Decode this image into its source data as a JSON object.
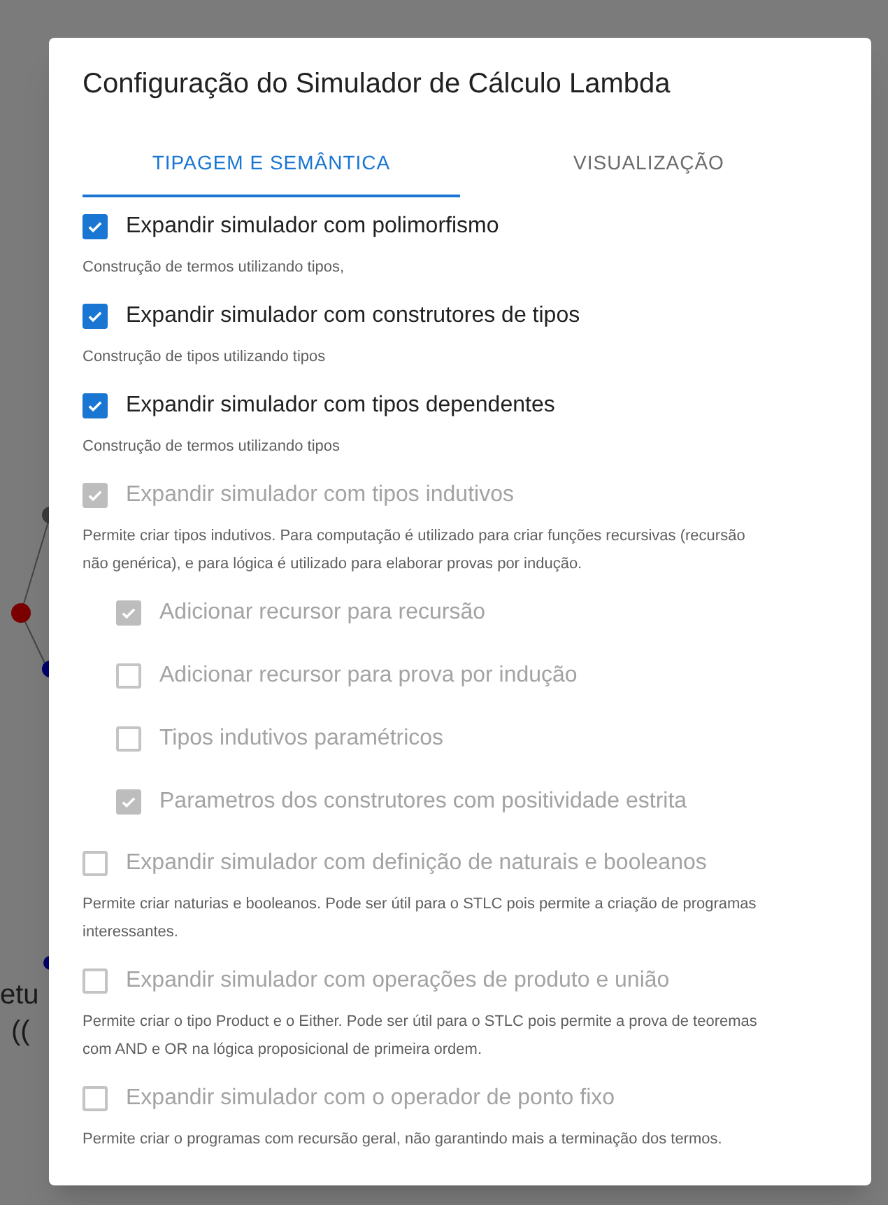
{
  "background": {
    "fragments": [
      "etu",
      "(("
    ]
  },
  "dialog": {
    "title": "Configuração do Simulador de Cálculo Lambda",
    "tabs": [
      {
        "label": "TIPAGEM E SEMÂNTICA",
        "selected": true
      },
      {
        "label": "VISUALIZAÇÃO",
        "selected": false
      }
    ],
    "options": [
      {
        "label": "Expandir simulador com polimorfismo",
        "checked": true,
        "disabled": false,
        "description": "Construção de termos utilizando tipos,"
      },
      {
        "label": "Expandir simulador com construtores de tipos",
        "checked": true,
        "disabled": false,
        "description": "Construção de tipos utilizando tipos"
      },
      {
        "label": "Expandir simulador com tipos dependentes",
        "checked": true,
        "disabled": false,
        "description": "Construção de termos utilizando tipos"
      },
      {
        "label": "Expandir simulador com tipos indutivos",
        "checked": true,
        "disabled": true,
        "description": "Permite criar tipos indutivos. Para computação é utilizado para criar funções recursivas (recursão não genérica), e para lógica é utilizado para elaborar provas por indução.",
        "children": [
          {
            "label": "Adicionar recursor para recursão",
            "checked": true,
            "disabled": true
          },
          {
            "label": "Adicionar recursor para prova por indução",
            "checked": false,
            "disabled": true
          },
          {
            "label": "Tipos indutivos paramétricos",
            "checked": false,
            "disabled": true
          },
          {
            "label": "Parametros dos construtores com positividade estrita",
            "checked": true,
            "disabled": true
          }
        ]
      },
      {
        "label": "Expandir simulador com definição de naturais e booleanos",
        "checked": false,
        "disabled": true,
        "description": "Permite criar naturias e booleanos. Pode ser útil para o STLC pois permite a criação de programas interessantes."
      },
      {
        "label": "Expandir simulador com operações de produto e união",
        "checked": false,
        "disabled": true,
        "description": "Permite criar o tipo Product e o Either. Pode ser útil para o STLC pois permite a prova de teoremas com AND e OR na lógica proposicional de primeira ordem."
      },
      {
        "label": "Expandir simulador com o operador de ponto fixo",
        "checked": false,
        "disabled": true,
        "description": "Permite criar o programas com recursão geral, não garantindo mais a terminação dos termos."
      }
    ]
  }
}
